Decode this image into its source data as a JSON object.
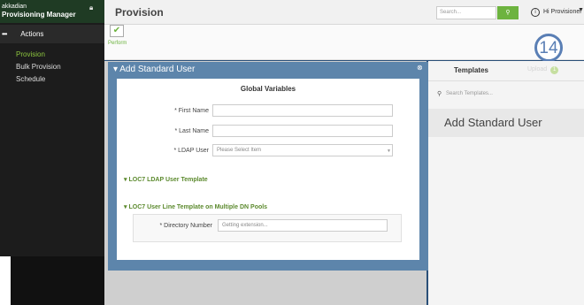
{
  "sidebar": {
    "brand_line1": "akkadian",
    "brand_line2": "Provisioning Manager",
    "actions_label": "Actions",
    "items": [
      {
        "label": "Provision"
      },
      {
        "label": "Bulk Provision"
      },
      {
        "label": "Schedule"
      }
    ]
  },
  "header": {
    "title": "Provision",
    "search_placeholder": "Search...",
    "user_label": "Hi Provisioner"
  },
  "toolbar": {
    "perform_label": "Perform",
    "badge_number": "14"
  },
  "modal": {
    "title": "Add Standard User",
    "section_title": "Global Variables",
    "fields": {
      "first_name_label": "* First Name",
      "first_name_value": "",
      "last_name_label": "* Last Name",
      "last_name_value": "",
      "ldap_label": "* LDAP User",
      "ldap_placeholder": "Please Select Item",
      "directory_label": "* Directory Number",
      "directory_value": "Getting extension..."
    },
    "sections": {
      "ldap_template": "LOC7 LDAP User Template",
      "line_template": "LOC7 User Line Template on Multiple DN Pools"
    }
  },
  "right_pane": {
    "tab_templates": "Templates",
    "tab_upload": "Upload",
    "upload_count": "1",
    "search_placeholder": "Search Templates...",
    "template_item": "Add Standard User"
  },
  "colors": {
    "accent_green": "#6db33f",
    "modal_blue": "#5d85ab",
    "badge_blue": "#5a7fb5"
  }
}
